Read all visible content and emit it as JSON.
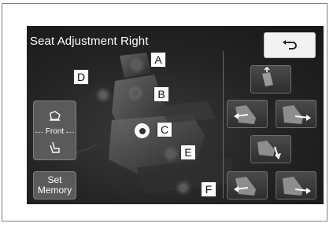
{
  "screen": {
    "title": "Seat Adjustment Right"
  },
  "buttons": {
    "front_label": "Front",
    "memory_label_line1": "Set",
    "memory_label_line2": "Memory"
  },
  "tags": {
    "a": "A",
    "b": "B",
    "c": "C",
    "d": "D",
    "e": "E",
    "f": "F"
  },
  "icons": {
    "back": "back-arrow-icon",
    "seat_top": "seat-cushion-icon",
    "seat_bottom": "seat-recline-icon",
    "seat_controls": [
      "seat-headrest-up-icon",
      "seat-slide-forward-icon",
      "seat-slide-back-icon",
      "seat-cushion-tilt-icon",
      "seat-lumbar-forward-icon",
      "seat-lumbar-back-icon"
    ]
  },
  "colors": {
    "panel": "#1f1f1f",
    "button_light": "#f2f2f2",
    "button_dark": "#5a5a5a",
    "tag_bg": "#ffffff"
  }
}
